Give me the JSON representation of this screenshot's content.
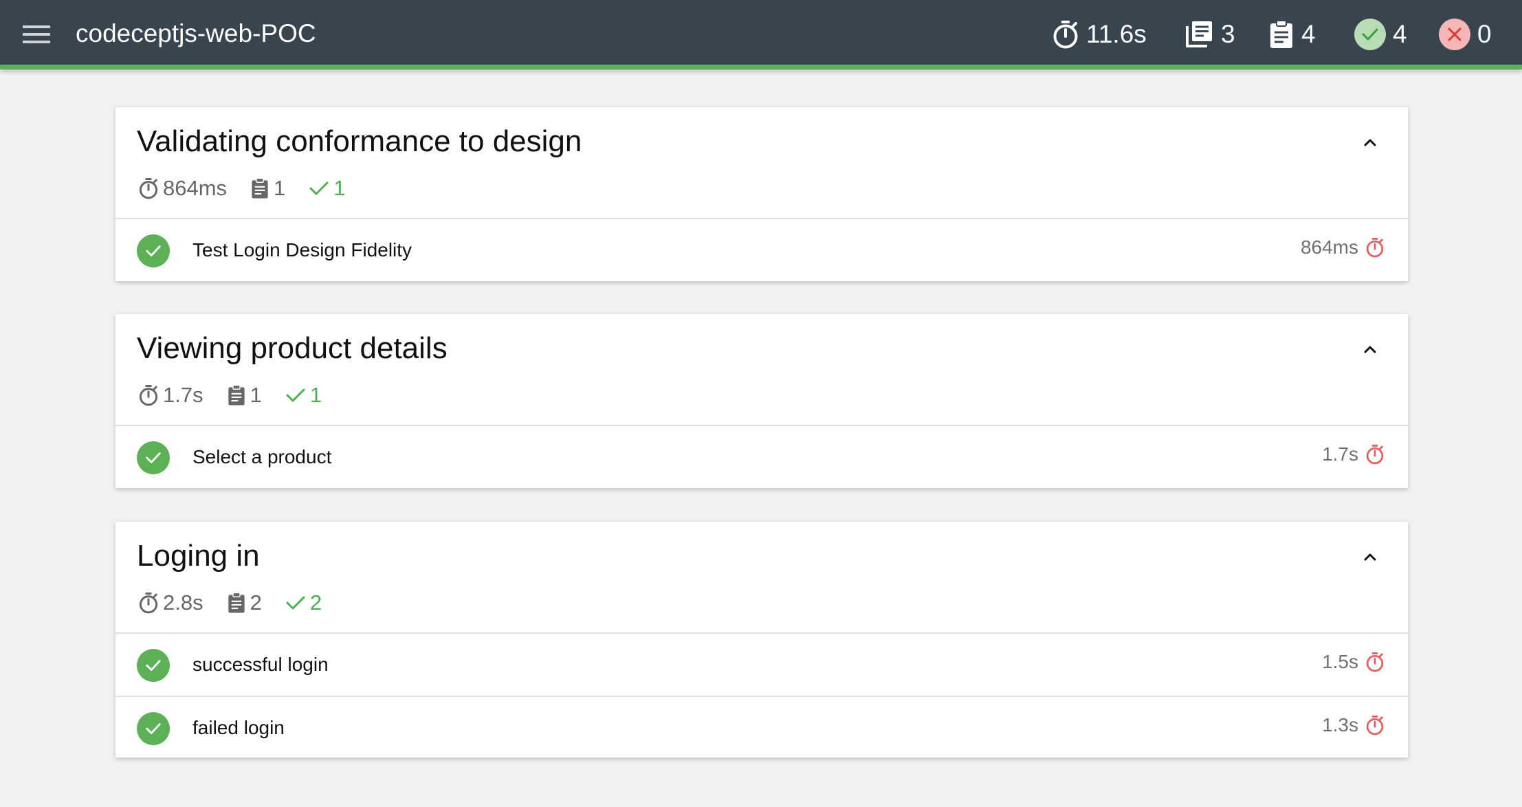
{
  "header": {
    "title": "codeceptjs-web-POC",
    "stats": {
      "duration": "11.6s",
      "suites": "3",
      "tests": "4",
      "passed": "4",
      "failed": "0"
    }
  },
  "colors": {
    "topbar": "#38444e",
    "topbar_accent": "#5cb157",
    "pass": "#5cb157",
    "fail": "#e06060",
    "duration_icon": "#e06060"
  },
  "icons": {
    "menu": "menu-icon",
    "timer": "timer-icon",
    "suites": "library-books-icon",
    "tests": "clipboard-icon",
    "passed": "check-circle-icon",
    "failed": "close-circle-icon",
    "collapse": "chevron-up-icon"
  },
  "suites": [
    {
      "title": "Validating conformance to design",
      "duration": "864ms",
      "tests": "1",
      "passed": "1",
      "items": [
        {
          "title": "Test Login Design Fidelity",
          "duration": "864ms",
          "status": "passed"
        }
      ]
    },
    {
      "title": "Viewing product details",
      "duration": "1.7s",
      "tests": "1",
      "passed": "1",
      "items": [
        {
          "title": "Select a product",
          "duration": "1.7s",
          "status": "passed"
        }
      ]
    },
    {
      "title": "Loging in",
      "duration": "2.8s",
      "tests": "2",
      "passed": "2",
      "items": [
        {
          "title": "successful login",
          "duration": "1.5s",
          "status": "passed"
        },
        {
          "title": "failed login",
          "duration": "1.3s",
          "status": "passed"
        }
      ]
    }
  ]
}
